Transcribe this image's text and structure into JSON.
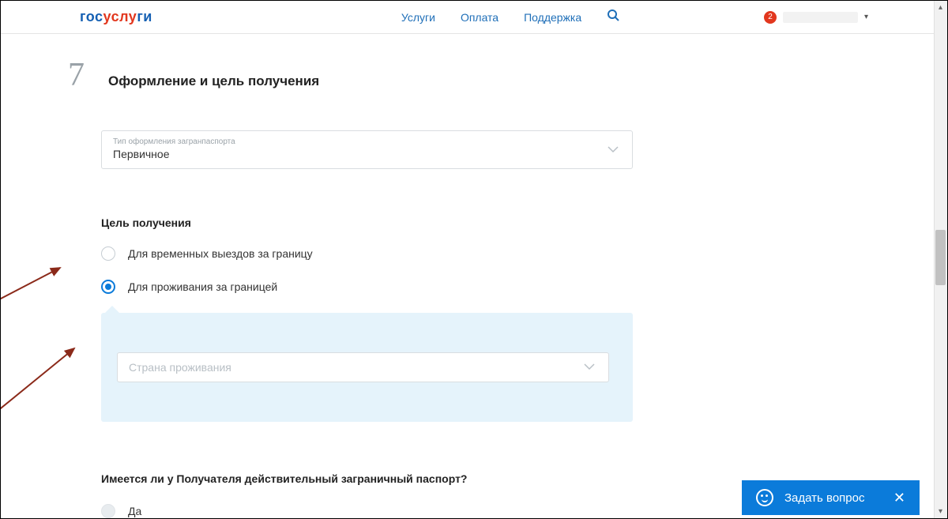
{
  "header": {
    "logo": {
      "p1": "гос",
      "p2": "услу",
      "p3": "ги"
    },
    "nav": {
      "services": "Услуги",
      "payment": "Оплата",
      "support": "Поддержка"
    },
    "badge_count": "2"
  },
  "step": {
    "number": "7",
    "title": "Оформление и цель получения"
  },
  "type_select": {
    "label": "Тип оформления загранпаспорта",
    "value": "Первичное"
  },
  "purpose": {
    "heading": "Цель получения",
    "options": [
      {
        "label": "Для временных выездов за границу",
        "selected": false
      },
      {
        "label": "Для проживания за границей",
        "selected": true
      }
    ]
  },
  "country_select": {
    "placeholder": "Страна проживания"
  },
  "existing_passport": {
    "question": "Имеется ли у Получателя действительный заграничный паспорт?",
    "options": [
      {
        "label": "Да"
      }
    ]
  },
  "ask_bar": {
    "label": "Задать вопрос"
  }
}
